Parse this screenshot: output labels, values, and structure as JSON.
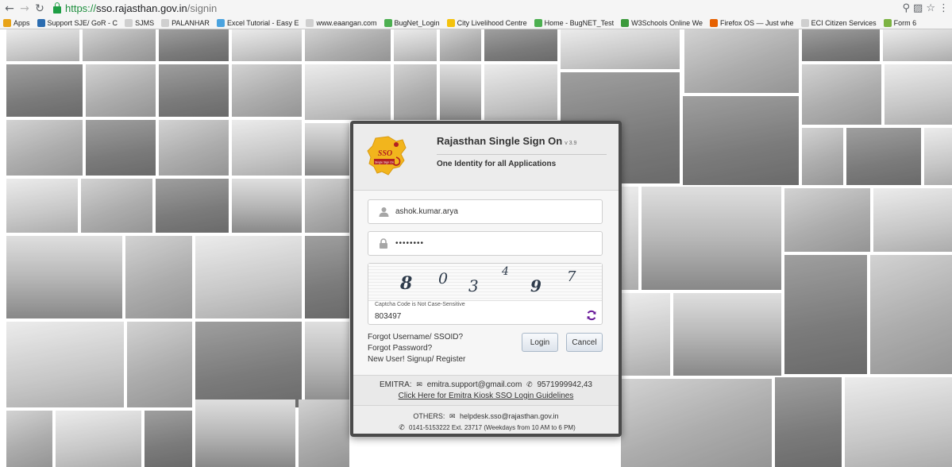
{
  "browser": {
    "url_scheme": "https://",
    "url_host": "sso.rajasthan.gov.in",
    "url_path": "/signin",
    "bookmarks": [
      {
        "label": "Apps",
        "color": "#e8a317"
      },
      {
        "label": "Support SJE/ GoR - C",
        "color": "#2b6cb0"
      },
      {
        "label": "SJMS",
        "color": "#cfcfcf"
      },
      {
        "label": "PALANHAR",
        "color": "#cfcfcf"
      },
      {
        "label": "Excel Tutorial - Easy E",
        "color": "#4aa3df"
      },
      {
        "label": "www.eaangan.com",
        "color": "#cfcfcf"
      },
      {
        "label": "BugNet_Login",
        "color": "#4caf50"
      },
      {
        "label": "City Livelihood Centre",
        "color": "#f4c20d"
      },
      {
        "label": "Home - BugNET_Test",
        "color": "#4caf50"
      },
      {
        "label": "W3Schools Online We",
        "color": "#3c9a3c"
      },
      {
        "label": "Firefox OS — Just whe",
        "color": "#e66000"
      },
      {
        "label": "ECI Citizen Services",
        "color": "#cfcfcf"
      },
      {
        "label": "Form 6",
        "color": "#7cb342"
      }
    ]
  },
  "login": {
    "title": "Rajasthan Single Sign On",
    "version": "v 3.9",
    "tagline": "One Identity for all Applications",
    "logo_text": "SSO",
    "logo_subtext": "Single Sign On",
    "username_value": "ashok.kumar.arya",
    "password_value": "••••••••",
    "captcha_digits": [
      "8",
      "0",
      "3",
      "4",
      "9",
      "7"
    ],
    "captcha_hint": "Captcha Code is Not Case-Sensitive",
    "captcha_value": "803497",
    "forgot_username": "Forgot Username/ SSOID?",
    "forgot_password": "Forgot Password?",
    "signup": "New User! Signup/ Register",
    "login_button": "Login",
    "cancel_button": "Cancel"
  },
  "emitra": {
    "label": "EMITRA:",
    "email": "emitra.support@gmail.com",
    "phone": "9571999942,43",
    "guidelines_link": "Click Here for Emitra Kiosk SSO Login Guidelines"
  },
  "others": {
    "label": "OTHERS:",
    "email": "helpdesk.sso@rajasthan.gov.in",
    "phone": "0141-5153222 Ext. 23717",
    "hours": "(Weekdays from 10 AM to 6 PM)"
  },
  "colors": {
    "modal_frame": "#4a4a4a",
    "url_green": "#1e8e3e",
    "refresh_purple": "#6a1b9a"
  }
}
